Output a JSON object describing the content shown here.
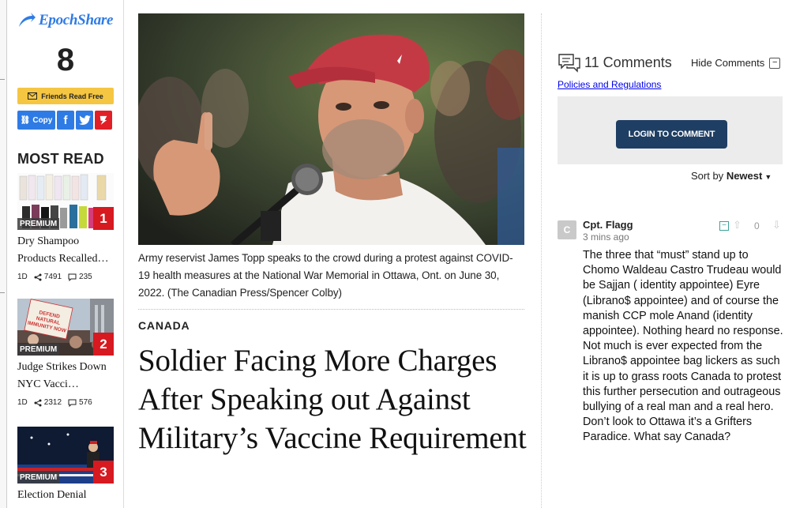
{
  "share": {
    "brand": "EpochShare",
    "count": "8",
    "friends_label": "Friends Read Free",
    "copy_label": "Copy",
    "facebook_glyph": "f",
    "twitter_glyph": "t",
    "gettr_glyph": "g"
  },
  "most_read": {
    "heading": "MOST READ",
    "items": [
      {
        "badge": "PREMIUM",
        "rank": "1",
        "title": "Dry Shampoo Products Recalled…",
        "age": "1D",
        "shares": "7491",
        "comments": "235"
      },
      {
        "badge": "PREMIUM",
        "rank": "2",
        "title": "Judge Strikes Down NYC Vacci…",
        "age": "1D",
        "shares": "2312",
        "comments": "576"
      },
      {
        "badge": "PREMIUM",
        "rank": "3",
        "title": "Election Denial"
      }
    ],
    "protest_sign": "DEFEND NATURAL IMMUNITY NOW"
  },
  "article": {
    "caption": "Army reservist James Topp speaks to the crowd during a protest against COVID-19 health measures at the National War Memorial in Ottawa, Ont. on June 30, 2022. (The Canadian Press/Spencer Colby)",
    "section": "CANADA",
    "headline": "Soldier Facing More Charges After Speaking out Against Military’s Vaccine Requirement"
  },
  "comments": {
    "count_label": "11 Comments",
    "hide_label": "Hide Comments",
    "policies_link": "Policies and Regulations",
    "login_label": "LOGIN TO COMMENT",
    "sort_prefix": "Sort by",
    "sort_value": "Newest",
    "items": [
      {
        "avatar_letter": "C",
        "author": "Cpt. Flagg",
        "time": "3 mins ago",
        "score": "0",
        "body": "The three that “must” stand up to Chomo Waldeau Castro Trudeau would be Sajjan ( identity appointee) Eyre (Librano$ appointee) and of course the manish CCP mole Anand (identity appointee). Nothing heard no response. Not much is ever expected from the Librano$ appointee bag lickers as such it is up to grass roots Canada to protest this further persecution and outrageous bullying of a real man and a real hero. Don’t look to Ottawa it’s a Grifters Paradice. What say Canada?"
      }
    ]
  },
  "colors": {
    "brand_blue": "#2f7be5",
    "friends_yellow": "#f5c642",
    "rank_red": "#d71920",
    "login_navy": "#1f3e63",
    "link_blue": "#0000ee"
  },
  "icons": [
    "epochshare-logo-icon",
    "mail-icon",
    "link-icon",
    "facebook-icon",
    "twitter-icon",
    "gettr-icon",
    "share-icon",
    "comment-icon",
    "comments-bubble-icon",
    "collapse-icon",
    "upvote-icon",
    "downvote-icon",
    "caret-down-icon"
  ]
}
